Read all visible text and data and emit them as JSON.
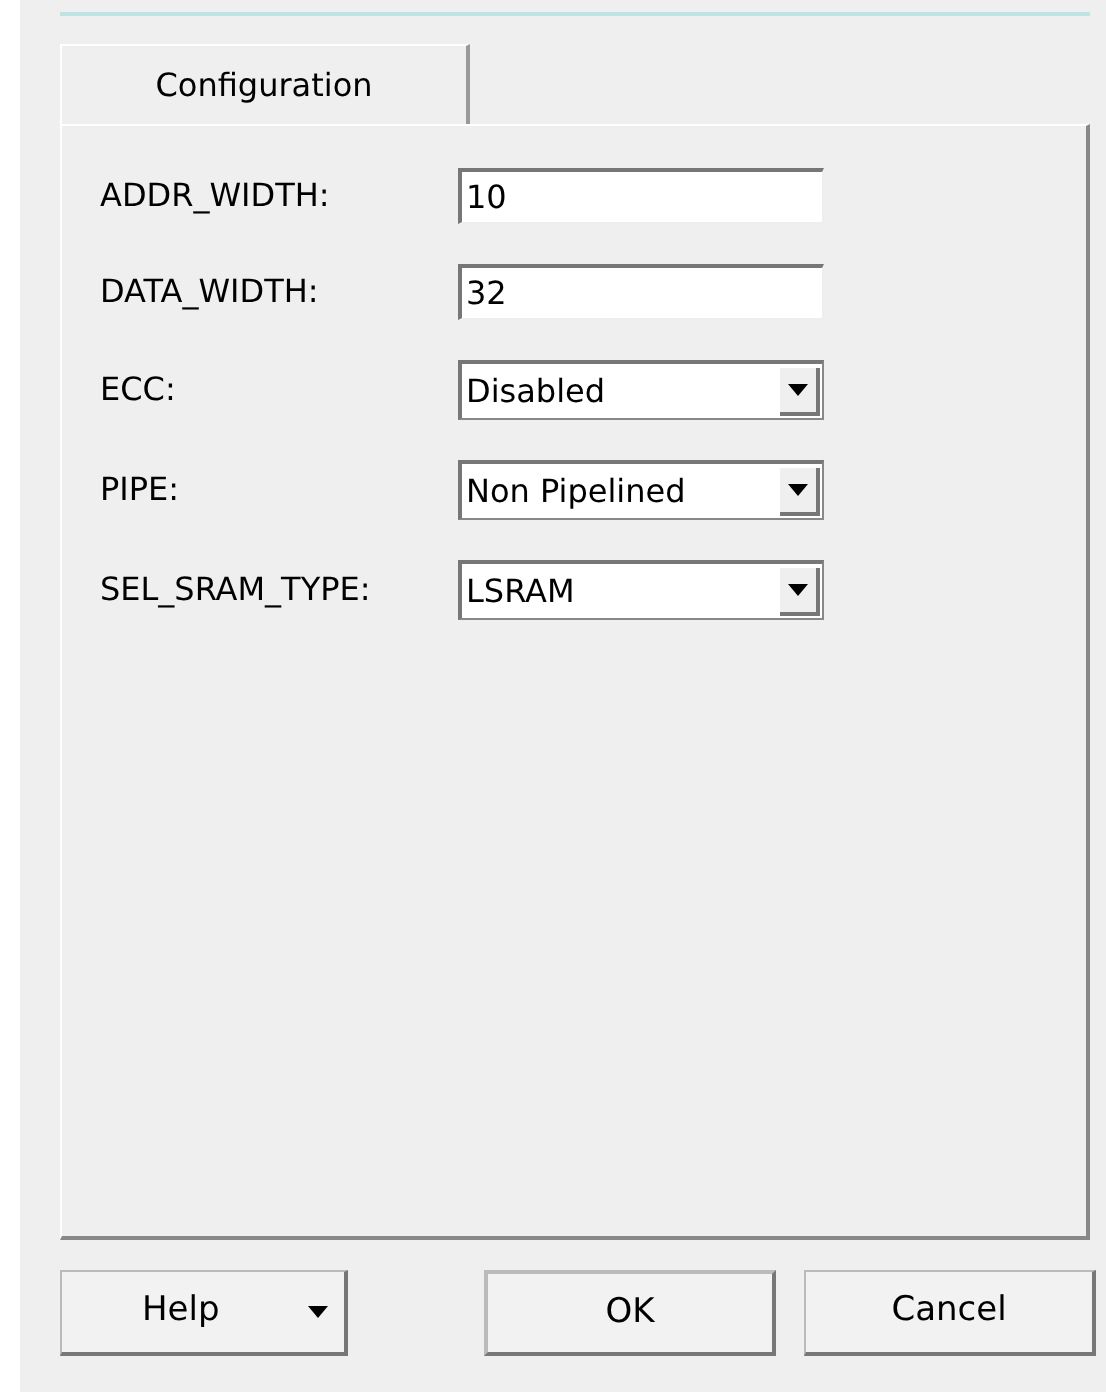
{
  "tabs": [
    {
      "label": "Configuration",
      "selected": true
    }
  ],
  "fields": [
    {
      "label": "ADDR_WIDTH:",
      "kind": "text",
      "value": "10"
    },
    {
      "label": "DATA_WIDTH:",
      "kind": "text",
      "value": "32"
    },
    {
      "label": "ECC:",
      "kind": "select",
      "value": "Disabled"
    },
    {
      "label": "PIPE:",
      "kind": "select",
      "value": "Non Pipelined"
    },
    {
      "label": "SEL_SRAM_TYPE:",
      "kind": "select",
      "value": "LSRAM"
    }
  ],
  "buttons": [
    {
      "label": "Help",
      "kind": "menu"
    },
    {
      "label": "OK",
      "kind": "default"
    },
    {
      "label": "Cancel",
      "kind": "plain"
    }
  ]
}
